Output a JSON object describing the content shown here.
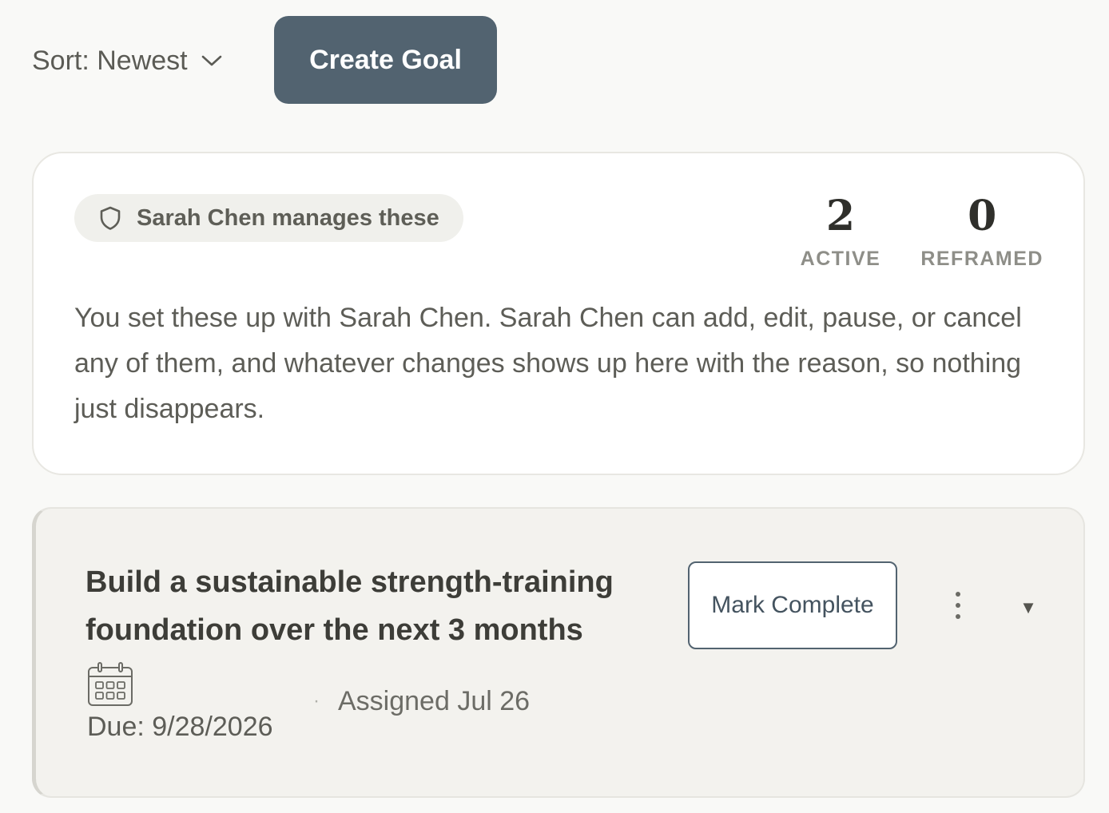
{
  "toolbar": {
    "sort_label": "Sort: Newest",
    "create_label": "Create Goal"
  },
  "manager": {
    "pill_label": "Sarah Chen manages these",
    "description": "You set these up with Sarah Chen. Sarah Chen can add, edit, pause, or cancel any of them, and whatever changes shows up here with the reason, so nothing just disappears.",
    "stats": [
      {
        "value": "2",
        "label": "ACTIVE"
      },
      {
        "value": "0",
        "label": "REFRAMED"
      }
    ]
  },
  "goal": {
    "title": "Build a sustainable strength-training foundation over the next 3 months",
    "mark_complete_label": "Mark Complete",
    "expand_glyph": "▼",
    "due": "Due: 9/28/2026",
    "separator": "·",
    "assigned": "Assigned Jul 26"
  },
  "icons": {
    "sort": "chevron-down-icon",
    "manager": "shield-icon",
    "more": "more-vertical-icon",
    "expand": "triangle-down-icon",
    "due": "calendar-icon"
  },
  "colors": {
    "page_bg": "#f9f9f7",
    "primary_button": "#526370",
    "card_bg": "#ffffff",
    "goal_card_bg": "#f3f2ee",
    "text": "#5d5d57",
    "stat_value": "#2f2f2b"
  }
}
